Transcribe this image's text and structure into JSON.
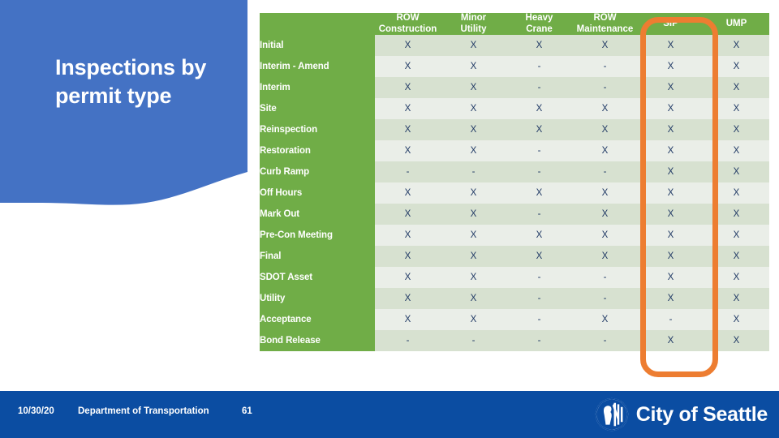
{
  "slide": {
    "title": "Inspections by permit type",
    "colors": {
      "title_block_blue": "#4472C4",
      "table_green": "#70AD47",
      "band_dark": "#D7E1D0",
      "band_light": "#EAEEE8",
      "highlight_orange": "#ED7D31",
      "footer_blue": "#0B4DA2",
      "mark_navy": "#1F3864"
    }
  },
  "table": {
    "corner_label": "",
    "columns": [
      {
        "line1": "ROW",
        "line2": "Construction"
      },
      {
        "line1": "Minor",
        "line2": "Utility"
      },
      {
        "line1": "Heavy",
        "line2": "Crane"
      },
      {
        "line1": "ROW",
        "line2": "Maintenance"
      },
      {
        "line1": "SIP",
        "line2": ""
      },
      {
        "line1": "UMP",
        "line2": ""
      }
    ],
    "rows": [
      {
        "label": "Initial",
        "cells": [
          "X",
          "X",
          "X",
          "X",
          "X",
          "X"
        ]
      },
      {
        "label": "Interim - Amend",
        "cells": [
          "X",
          "X",
          "-",
          "-",
          "X",
          "X"
        ]
      },
      {
        "label": "Interim",
        "cells": [
          "X",
          "X",
          "-",
          "-",
          "X",
          "X"
        ]
      },
      {
        "label": "Site",
        "cells": [
          "X",
          "X",
          "X",
          "X",
          "X",
          "X"
        ]
      },
      {
        "label": "Reinspection",
        "cells": [
          "X",
          "X",
          "X",
          "X",
          "X",
          "X"
        ]
      },
      {
        "label": "Restoration",
        "cells": [
          "X",
          "X",
          "-",
          "X",
          "X",
          "X"
        ]
      },
      {
        "label": "Curb Ramp",
        "cells": [
          "-",
          "-",
          "-",
          "-",
          "X",
          "X"
        ]
      },
      {
        "label": "Off Hours",
        "cells": [
          "X",
          "X",
          "X",
          "X",
          "X",
          "X"
        ]
      },
      {
        "label": "Mark Out",
        "cells": [
          "X",
          "X",
          "-",
          "X",
          "X",
          "X"
        ]
      },
      {
        "label": "Pre-Con Meeting",
        "cells": [
          "X",
          "X",
          "X",
          "X",
          "X",
          "X"
        ]
      },
      {
        "label": "Final",
        "cells": [
          "X",
          "X",
          "X",
          "X",
          "X",
          "X"
        ]
      },
      {
        "label": "SDOT Asset",
        "cells": [
          "X",
          "X",
          "-",
          "-",
          "X",
          "X"
        ]
      },
      {
        "label": "Utility",
        "cells": [
          "X",
          "X",
          "-",
          "-",
          "X",
          "X"
        ]
      },
      {
        "label": "Acceptance",
        "cells": [
          "X",
          "X",
          "-",
          "X",
          "-",
          "X"
        ]
      },
      {
        "label": "Bond Release",
        "cells": [
          "-",
          "-",
          "-",
          "-",
          "X",
          "X"
        ]
      }
    ]
  },
  "highlight": {
    "target_column": "SIP",
    "shape": "rounded-rectangle",
    "color": "#ED7D31"
  },
  "footer": {
    "date": "10/30/20",
    "department": "Department of Transportation",
    "page_number": "61",
    "brand_text": "City of Seattle",
    "brand_icon": "seattle-city-seal-icon"
  }
}
